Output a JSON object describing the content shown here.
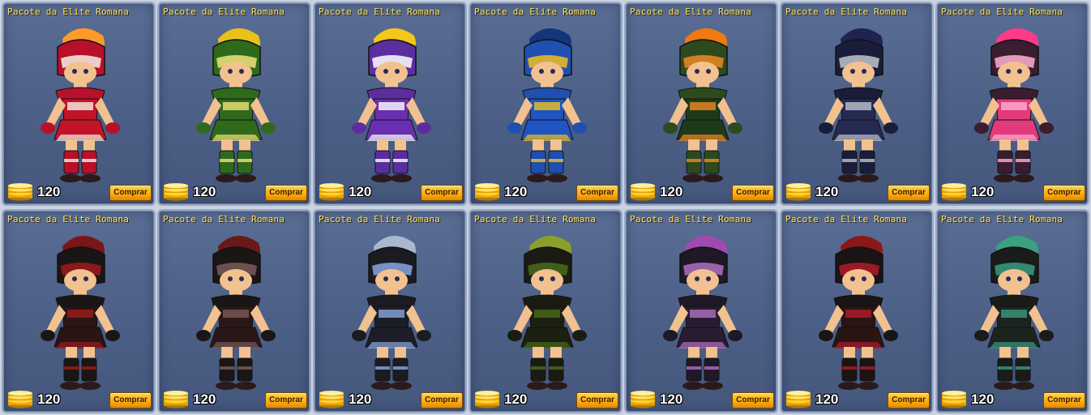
{
  "shop": {
    "currency_icon": "gold-coin-stack-icon",
    "items": [
      {
        "title": "Pacote da Elite Romana",
        "price": "120",
        "buy_label": "Comprar",
        "colors": {
          "helmet": "#b8102a",
          "plume": "#ff9a2a",
          "body": "#c21428",
          "accent": "#f3f0e6"
        }
      },
      {
        "title": "Pacote da Elite Romana",
        "price": "120",
        "buy_label": "Comprar",
        "colors": {
          "helmet": "#2f6a1c",
          "plume": "#e8c21a",
          "body": "#2f6a1c",
          "accent": "#f1e37a"
        }
      },
      {
        "title": "Pacote da Elite Romana",
        "price": "120",
        "buy_label": "Comprar",
        "colors": {
          "helmet": "#5b2ea0",
          "plume": "#f3c81a",
          "body": "#6a2fb0",
          "accent": "#ffffff"
        }
      },
      {
        "title": "Pacote da Elite Romana",
        "price": "120",
        "buy_label": "Comprar",
        "colors": {
          "helmet": "#1f4fb0",
          "plume": "#13357a",
          "body": "#1e55c2",
          "accent": "#f0c020"
        }
      },
      {
        "title": "Pacote da Elite Romana",
        "price": "120",
        "buy_label": "Comprar",
        "colors": {
          "helmet": "#2c4a1e",
          "plume": "#f07a10",
          "body": "#1f3a18",
          "accent": "#f08a20"
        }
      },
      {
        "title": "Pacote da Elite Romana",
        "price": "120",
        "buy_label": "Comprar",
        "colors": {
          "helmet": "#1a1d3a",
          "plume": "#1e2350",
          "body": "#252a52",
          "accent": "#c0c4cc"
        }
      },
      {
        "title": "Pacote da Elite Romana",
        "price": "120",
        "buy_label": "Comprar",
        "colors": {
          "helmet": "#3a1d30",
          "plume": "#ff3a8a",
          "body": "#e23a7a",
          "accent": "#ffb0cf"
        }
      },
      {
        "title": "Pacote da Elite Romana",
        "price": "120",
        "buy_label": "Comprar",
        "colors": {
          "helmet": "#1a1616",
          "plume": "#7a1616",
          "body": "#2a1414",
          "accent": "#a01a1a"
        }
      },
      {
        "title": "Pacote da Elite Romana",
        "price": "120",
        "buy_label": "Comprar",
        "colors": {
          "helmet": "#1a1616",
          "plume": "#6a1818",
          "body": "#2a1818",
          "accent": "#7a5a58"
        }
      },
      {
        "title": "Pacote da Elite Romana",
        "price": "120",
        "buy_label": "Comprar",
        "colors": {
          "helmet": "#1a1c22",
          "plume": "#a9b7cf",
          "body": "#1c1e26",
          "accent": "#8aa6e0"
        }
      },
      {
        "title": "Pacote da Elite Romana",
        "price": "120",
        "buy_label": "Comprar",
        "colors": {
          "helmet": "#1a1c14",
          "plume": "#8aa02a",
          "body": "#1c2010",
          "accent": "#4a6a1a"
        }
      },
      {
        "title": "Pacote da Elite Romana",
        "price": "120",
        "buy_label": "Comprar",
        "colors": {
          "helmet": "#1f1826",
          "plume": "#a04ab0",
          "body": "#2a1c30",
          "accent": "#b070c0"
        }
      },
      {
        "title": "Pacote da Elite Romana",
        "price": "120",
        "buy_label": "Comprar",
        "colors": {
          "helmet": "#1a1414",
          "plume": "#8a1818",
          "body": "#2a1414",
          "accent": "#b01a2a"
        }
      },
      {
        "title": "Pacote da Elite Romana",
        "price": "120",
        "buy_label": "Comprar",
        "colors": {
          "helmet": "#1a1c1a",
          "plume": "#3aa080",
          "body": "#1c2420",
          "accent": "#3a9a80"
        }
      }
    ]
  }
}
